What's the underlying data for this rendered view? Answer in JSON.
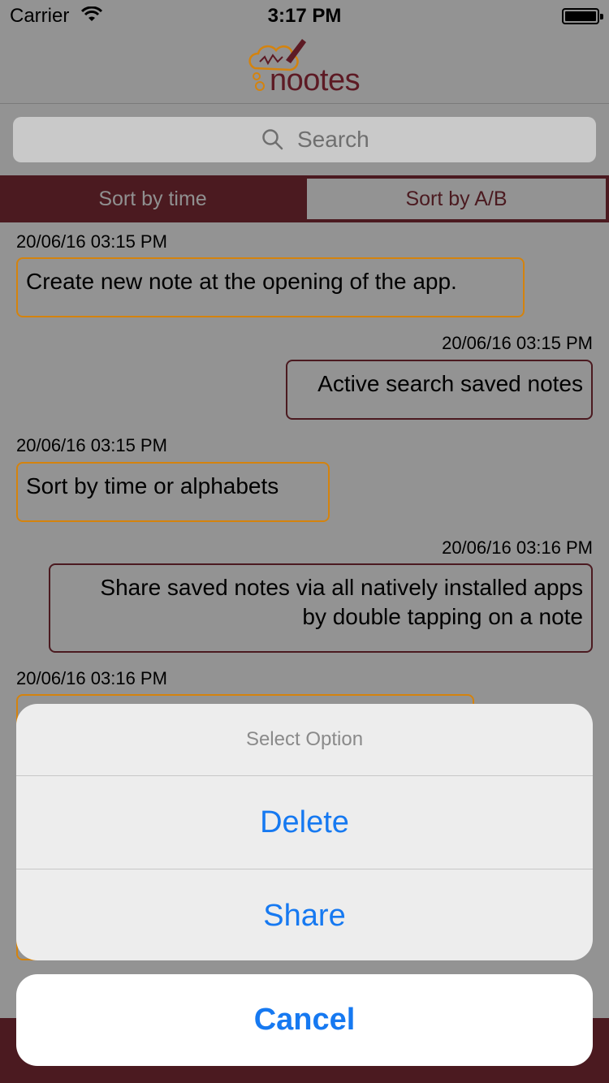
{
  "status": {
    "carrier": "Carrier",
    "time": "3:17 PM"
  },
  "header": {
    "logo_text": "nootes"
  },
  "search": {
    "placeholder": "Search"
  },
  "sort": {
    "by_time": "Sort by time",
    "by_ab": "Sort by A/B"
  },
  "notes": [
    {
      "timestamp": "20/06/16 03:15 PM",
      "text": "Create new note at the opening of the app.",
      "side": "left"
    },
    {
      "timestamp": "20/06/16 03:15 PM",
      "text": "Active search saved notes",
      "side": "right"
    },
    {
      "timestamp": "20/06/16 03:15 PM",
      "text": "Sort by time or alphabets",
      "side": "left"
    },
    {
      "timestamp": "20/06/16 03:16 PM",
      "text_line1": "Share saved notes via all natively installed apps",
      "text_line2": "by double tapping  on a note",
      "side": "right"
    },
    {
      "timestamp": "20/06/16 03:16 PM",
      "side": "left"
    }
  ],
  "action_sheet": {
    "title": "Select Option",
    "delete": "Delete",
    "share": "Share",
    "cancel": "Cancel"
  },
  "colors": {
    "brand": "#4b1a20",
    "note_left_border": "#d4830e",
    "action_blue": "#1679f1",
    "dim_background": "#939393"
  }
}
